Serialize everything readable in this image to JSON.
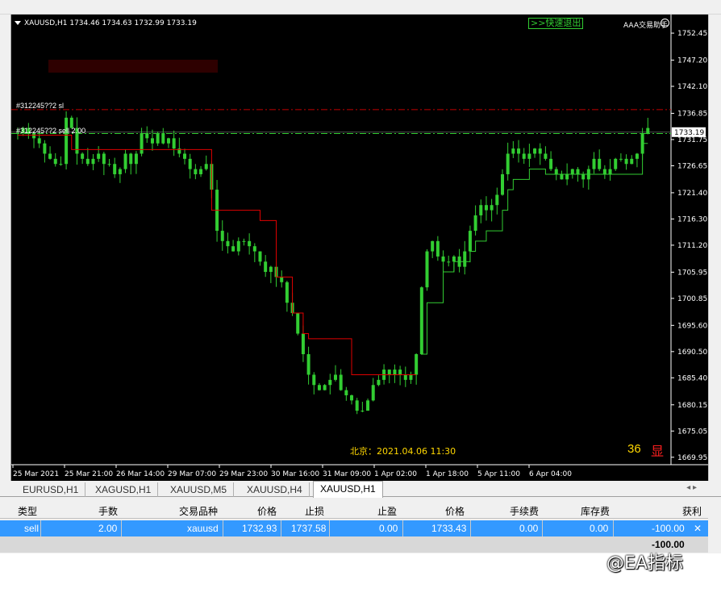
{
  "chart": {
    "symbol_header": "XAUUSD,H1  1734.46 1734.63 1732.99 1733.19",
    "quick_exit": ">>快速退出",
    "assistant": "AAA交易助手",
    "current_price": "1733.19",
    "order_sl_label": "#312245??2 sl",
    "order_label": "#312245??2 sell 2.00",
    "beijing_time": "北京：2021.04.06 11:30",
    "count": "36",
    "show_button": "显",
    "colors": {
      "background": "#000000",
      "bull": "#32cd32",
      "channel_top": "#e00000",
      "channel_bottom": "#32cd32",
      "sl_line": "#c00000",
      "entry_line": "#32cd32"
    }
  },
  "chart_data": {
    "type": "candlestick",
    "symbol": "XAUUSD",
    "timeframe": "H1",
    "y_ticks": [
      1752.45,
      1747.2,
      1742.1,
      1736.85,
      1731.75,
      1726.65,
      1721.4,
      1716.3,
      1711.2,
      1705.95,
      1700.85,
      1695.6,
      1690.5,
      1685.4,
      1680.15,
      1675.05,
      1669.95
    ],
    "ylim": [
      1668.5,
      1754.5
    ],
    "x_ticks": [
      "25 Mar 2021",
      "25 Mar 21:00",
      "26 Mar 14:00",
      "29 Mar 07:00",
      "29 Mar 23:00",
      "30 Mar 16:00",
      "31 Mar 09:00",
      "1 Apr 02:00",
      "1 Apr 18:00",
      "5 Apr 11:00",
      "6 Apr 04:00"
    ],
    "close_path": [
      1733,
      1734,
      1733,
      1732,
      1731,
      1729,
      1728,
      1727,
      1727,
      1736,
      1734,
      1729,
      1728,
      1727,
      1728,
      1729,
      1727,
      1727,
      1725,
      1726,
      1729,
      1727,
      1729,
      1733,
      1732,
      1731,
      1733,
      1731,
      1732,
      1730,
      1729,
      1728,
      1726,
      1725,
      1726,
      1727,
      1722,
      1714,
      1712,
      1711,
      1710,
      1712,
      1712,
      1711,
      1710,
      1708,
      1706,
      1707,
      1705,
      1704,
      1700,
      1698,
      1694,
      1690,
      1686,
      1684,
      1683,
      1684,
      1685,
      1686,
      1683,
      1682,
      1681,
      1679,
      1679,
      1681,
      1684,
      1685,
      1687,
      1686,
      1687,
      1686,
      1685,
      1686,
      1690,
      1703,
      1710,
      1712,
      1709,
      1708,
      1708,
      1709,
      1707,
      1710,
      1714,
      1717,
      1719,
      1718,
      1719,
      1721,
      1725,
      1729,
      1730,
      1729,
      1728,
      1729,
      1730,
      1729,
      1728,
      1726,
      1725,
      1724,
      1725,
      1726,
      1725,
      1724,
      1726,
      1728,
      1726,
      1725,
      1726,
      1728,
      1728,
      1727,
      1728,
      1729,
      1733,
      1734
    ],
    "channel_upper": [
      1732.6,
      1732.6,
      1732.6,
      1732.6,
      1732.6,
      1732.6,
      1732.6,
      1732.6,
      1732.6,
      1732.6,
      1729.8,
      1729.8,
      1729.8,
      1729.8,
      1729.8,
      1729.8,
      1729.8,
      1729.8,
      1729.8,
      1729.8,
      1729.8,
      1729.8,
      1729.8,
      1729.8,
      1729.8,
      1729.8,
      1729.8,
      1729.8,
      1729.8,
      1729.8,
      1729.8,
      1729.8,
      1729.8,
      1729.8,
      1729.8,
      1729.8,
      1718,
      1718,
      1718,
      1718,
      1718,
      1718,
      1718,
      1718,
      1718,
      1716,
      1716,
      1716,
      1705,
      1705,
      1705,
      1698,
      1698,
      1694,
      1693,
      1693,
      1693,
      1693,
      1693,
      1693,
      1693,
      1693,
      1686,
      1686,
      1686,
      1686,
      1686,
      1686,
      1686,
      1686,
      1686,
      1686,
      1686,
      1686,
      1686
    ],
    "channel_lower_start_index": 75,
    "channel_lower": [
      1690,
      1700,
      1700,
      1700,
      1706,
      1706,
      1708,
      1708,
      1708,
      1710,
      1712,
      1712,
      1714,
      1714,
      1714,
      1718,
      1722,
      1724,
      1724,
      1724,
      1726,
      1726,
      1726,
      1725,
      1725,
      1725,
      1725,
      1725,
      1725,
      1725,
      1725,
      1725,
      1725,
      1725,
      1725,
      1725,
      1725,
      1725,
      1725,
      1725,
      1725,
      1731,
      1731
    ],
    "sl_price": 1737.58,
    "entry_price": 1732.93
  },
  "tabs": [
    "EURUSD,H1",
    "XAGUSD,H1",
    "XAUUSD,M5",
    "XAUUSD,H4",
    "XAUUSD,H1"
  ],
  "table": {
    "headers": [
      "类型",
      "手数",
      "交易品种",
      "价格",
      "止损",
      "止盈",
      "价格",
      "手续费",
      "库存费",
      "获利"
    ],
    "rows": [
      {
        "type": "sell",
        "lots": "2.00",
        "symbol": "xauusd",
        "price": "1732.93",
        "sl": "1737.58",
        "tp": "0.00",
        "cur_price": "1733.43",
        "commission": "0.00",
        "swap": "0.00",
        "profit": "-100.00"
      }
    ],
    "total_profit": "-100.00"
  },
  "watermark": "@EA指标"
}
